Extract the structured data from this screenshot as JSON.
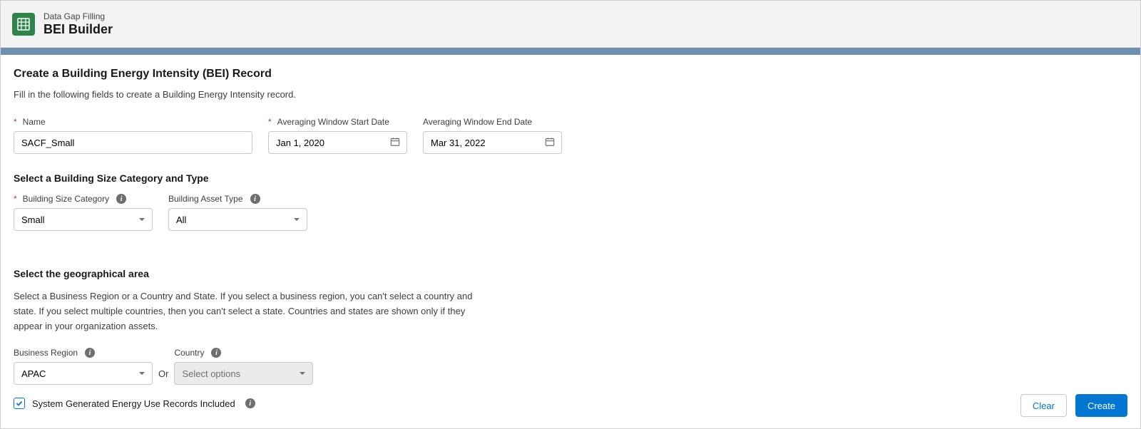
{
  "header": {
    "subtitle": "Data Gap Filling",
    "title": "BEI Builder"
  },
  "page": {
    "title": "Create a Building Energy Intensity (BEI) Record",
    "description": "Fill in the following fields to create a Building Energy Intensity record."
  },
  "fields": {
    "name": {
      "label": "Name",
      "value": "SACF_Small"
    },
    "start_date": {
      "label": "Averaging Window Start Date",
      "value": "Jan 1, 2020"
    },
    "end_date": {
      "label": "Averaging Window End Date",
      "value": "Mar 31, 2022"
    }
  },
  "section_size": {
    "title": "Select a Building Size Category and Type",
    "size_category": {
      "label": "Building Size Category",
      "value": "Small"
    },
    "asset_type": {
      "label": "Building Asset Type",
      "value": "All"
    }
  },
  "section_geo": {
    "title": "Select the geographical area",
    "description": "Select a Business Region or a Country and State. If you select a business region, you can't select a country and state. If you select multiple countries, then you can't select a state. Countries and states are shown only if they appear in your organization assets.",
    "business_region": {
      "label": "Business Region",
      "value": "APAC"
    },
    "or_label": "Or",
    "country": {
      "label": "Country",
      "placeholder": "Select options"
    }
  },
  "checkbox": {
    "label": "System Generated Energy Use Records Included",
    "checked": true
  },
  "footer": {
    "clear": "Clear",
    "create": "Create"
  }
}
